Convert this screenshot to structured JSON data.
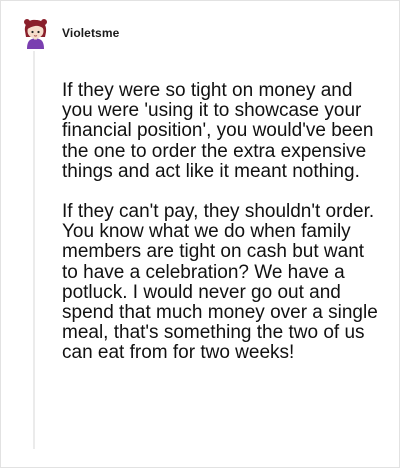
{
  "comment": {
    "username": "Violetsme",
    "avatar_icon": "cartoon-avatar-icon",
    "paragraphs": [
      "If they were so tight on money and you were 'using it to showcase your financial position', you would've been the one to order the extra expensive things and act like it meant nothing.",
      "If they can't pay, they shouldn't order. You know what we do when family members are tight on cash but want to have a celebration? We have a potluck. I would never go out and spend that much money over a single meal, that's something the two of us can eat from for two weeks!"
    ]
  },
  "colors": {
    "avatar_hair": "#8a1f2b",
    "avatar_shirt": "#7a3fb0",
    "border": "#e2e2e2",
    "thread_line": "#ebebeb"
  }
}
